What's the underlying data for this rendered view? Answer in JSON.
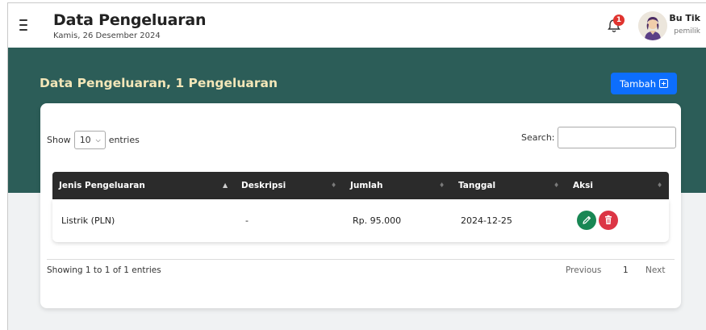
{
  "header": {
    "title": "Data Pengeluaran",
    "date": "Kamis, 26 Desember 2024",
    "notification_count": "1",
    "user_name": "Bu Tik",
    "user_role": "pemilik"
  },
  "section": {
    "title": "Data Pengeluaran, 1 Pengeluaran",
    "add_button_label": "Tambah"
  },
  "table_controls": {
    "show_label": "Show",
    "entries_value": "10",
    "entries_label": "entries",
    "search_label": "Search:",
    "search_value": ""
  },
  "table": {
    "columns": [
      "Jenis Pengeluaran",
      "Deskripsi",
      "Jumlah",
      "Tanggal",
      "Aksi"
    ],
    "rows": [
      [
        "Listrik (PLN)",
        "-",
        "Rp. 95.000",
        "2024-12-25"
      ]
    ]
  },
  "footer": {
    "info": "Showing 1 to 1 of 1 entries",
    "previous_label": "Previous",
    "page": "1",
    "next_label": "Next"
  },
  "colors": {
    "band": "#2c5d58",
    "band_title": "#f3e6b8",
    "primary": "#0d6efd",
    "edit": "#198754",
    "delete": "#dc3545",
    "table_header": "#2b2b2b",
    "badge": "#e0342f"
  },
  "icons": {
    "menu": "menu-icon",
    "notification": "bell-icon",
    "add": "plus-square-icon",
    "edit": "pencil-icon",
    "delete": "trash-icon",
    "sort": "sort-icon",
    "dropdown": "chevron-down-icon"
  }
}
